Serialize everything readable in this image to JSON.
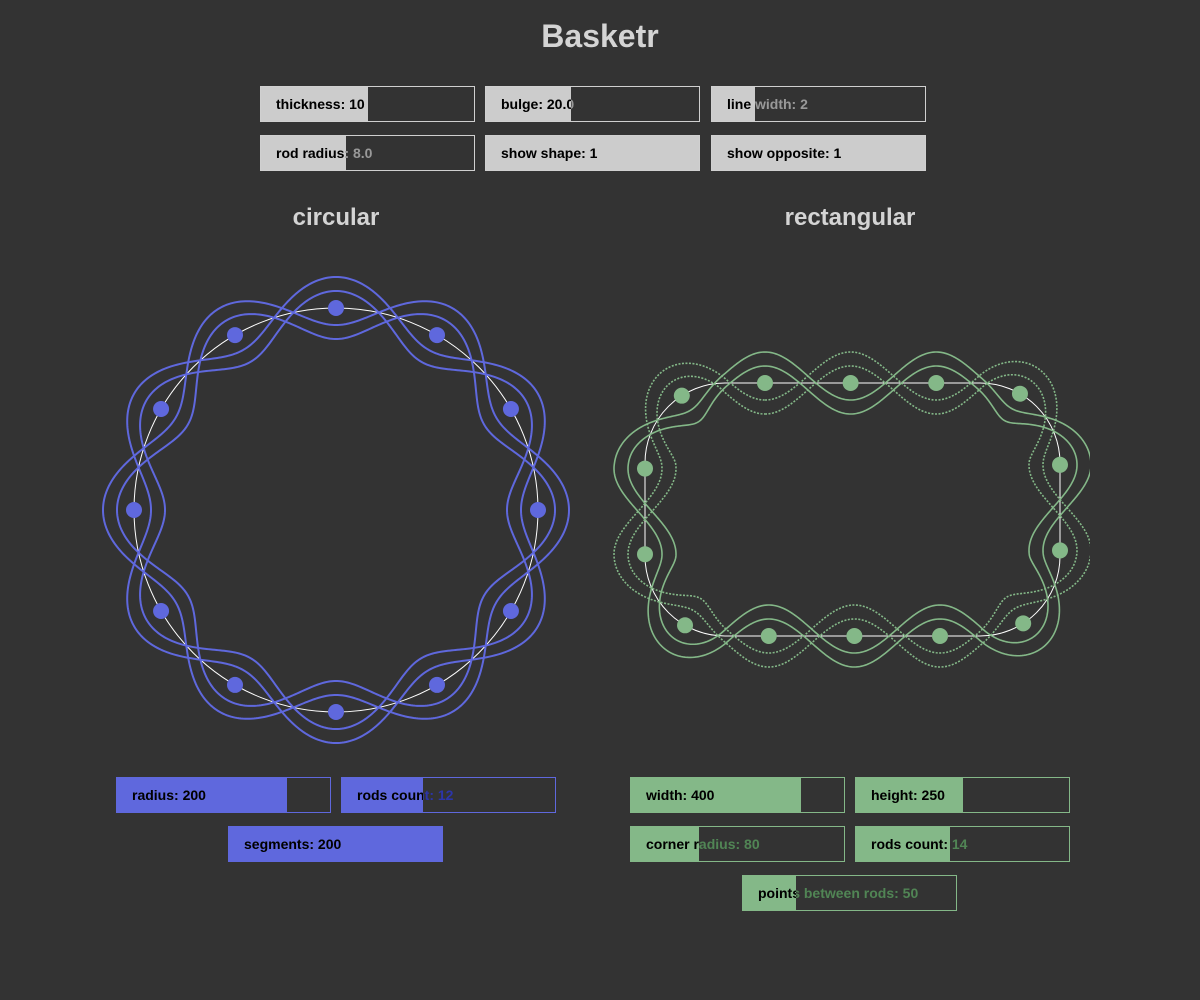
{
  "app": {
    "title": "Basketr"
  },
  "colors": {
    "background": "#333333",
    "neutral": "#cccccc",
    "circular": "#5f68dd",
    "rectangular": "#84b888",
    "guide": "#ffffff"
  },
  "global_controls": [
    {
      "label": "thickness: 10",
      "fraction": 0.5
    },
    {
      "label": "bulge: 20.0",
      "fraction": 0.4
    },
    {
      "label": "line width: 2",
      "fraction": 0.2
    },
    {
      "label": "rod radius: 8.0",
      "fraction": 0.4
    },
    {
      "label": "show shape: 1",
      "fraction": 1.0
    },
    {
      "label": "show opposite: 1",
      "fraction": 1.0
    }
  ],
  "circular": {
    "title": "circular",
    "controls": [
      {
        "label": "radius: 200",
        "fraction": 0.8
      },
      {
        "label": "rods count: 12",
        "fraction": 0.38
      },
      {
        "label": "segments: 200",
        "fraction": 1.0
      }
    ],
    "radius": 200,
    "rods_count": 12
  },
  "rectangular": {
    "title": "rectangular",
    "controls": [
      {
        "label": "width: 400",
        "fraction": 0.8
      },
      {
        "label": "height: 250",
        "fraction": 0.5
      },
      {
        "label": "corner radius: 80",
        "fraction": 0.32
      },
      {
        "label": "rods count: 14",
        "fraction": 0.44
      },
      {
        "label": "points between rods: 50",
        "fraction": 0.25
      }
    ],
    "width": 400,
    "height": 250,
    "corner_radius": 80,
    "rods_count": 14
  }
}
